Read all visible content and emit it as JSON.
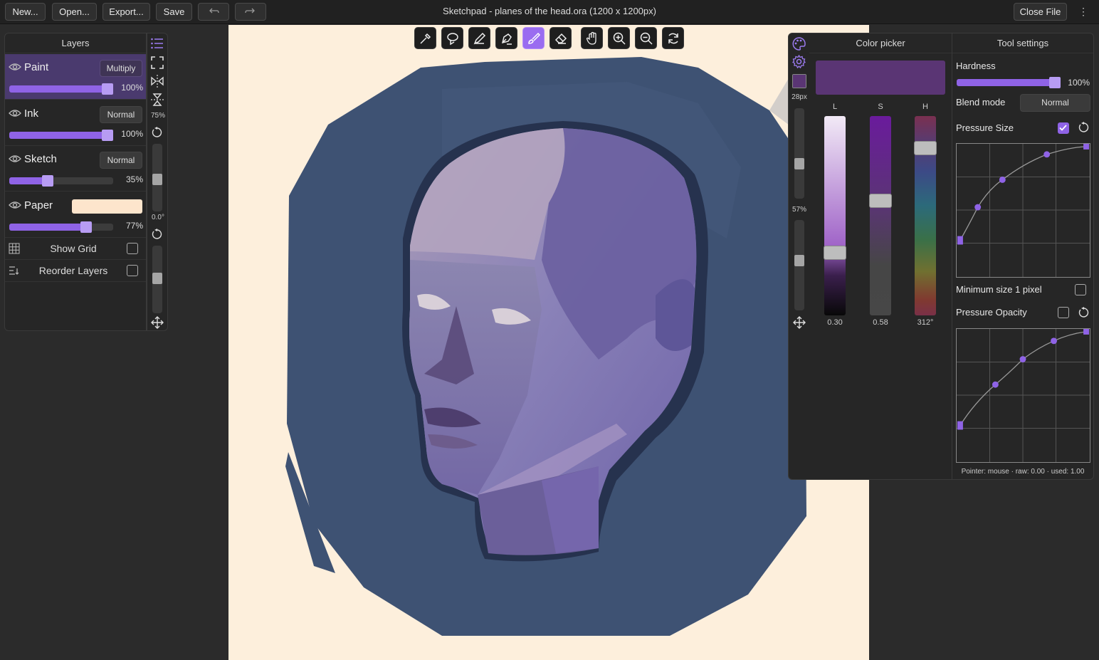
{
  "topbar": {
    "new_label": "New...",
    "open_label": "Open...",
    "export_label": "Export...",
    "save_label": "Save",
    "title": "Sketchpad - planes of the head.ora (1200 x 1200px)",
    "close_label": "Close File",
    "menu_glyph": "⋮"
  },
  "toolbar": {
    "tools": [
      "eyedropper-icon",
      "lasso-icon",
      "pencil-icon",
      "pen-icon",
      "brush-icon",
      "eraser-icon",
      "hand-icon",
      "zoom-in-icon",
      "zoom-out-icon",
      "reset-view-icon"
    ],
    "active": "brush-icon"
  },
  "layers": {
    "title": "Layers",
    "items": [
      {
        "name": "Paint",
        "mode": "Multiply",
        "opacity": "100%",
        "value": 1.0,
        "selected": true
      },
      {
        "name": "Ink",
        "mode": "Normal",
        "opacity": "100%",
        "value": 1.0
      },
      {
        "name": "Sketch",
        "mode": "Normal",
        "opacity": "35%",
        "value": 0.35
      },
      {
        "name": "Paper",
        "color": "#fde5cc",
        "opacity": "77%",
        "value": 0.77
      }
    ],
    "show_grid": "Show Grid",
    "reorder_layers": "Reorder Layers"
  },
  "view_strip": {
    "zoom": "75%",
    "rotation": "0.0°"
  },
  "brush_strip": {
    "size": "28px",
    "opacity": "57%",
    "current_color": "#5a3574"
  },
  "color_picker": {
    "title": "Color picker",
    "preview": "#5a3574",
    "channels": [
      {
        "label": "L",
        "value": "0.30",
        "level": 0.3
      },
      {
        "label": "S",
        "value": "0.58",
        "level": 0.58
      },
      {
        "label": "H",
        "value": "312°",
        "level": 0.867
      }
    ]
  },
  "tool_settings": {
    "title": "Tool settings",
    "hardness_label": "Hardness",
    "hardness_value": "100%",
    "hardness_level": 1.0,
    "blend_label": "Blend mode",
    "blend_value": "Normal",
    "pressure_size_label": "Pressure Size",
    "pressure_size_checked": true,
    "min_size_label": "Minimum size 1 pixel",
    "pressure_opacity_label": "Pressure Opacity",
    "pressure_opacity_checked": false,
    "pointer_status": "Pointer: mouse · raw: 0.00 · used: 1.00"
  },
  "colors": {
    "accent": "#8f63e6",
    "paper": "#fdefdc",
    "background_blob": "#3e5273"
  }
}
